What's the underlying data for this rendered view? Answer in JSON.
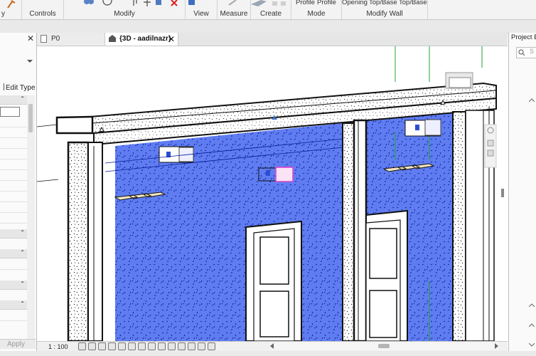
{
  "ribbon": {
    "groups": [
      {
        "id": "modify-partial",
        "label": "y"
      },
      {
        "id": "controls",
        "label": "Controls"
      },
      {
        "id": "modify",
        "label": "Modify"
      },
      {
        "id": "view",
        "label": "View"
      },
      {
        "id": "measure",
        "label": "Measure"
      },
      {
        "id": "create",
        "label": "Create"
      },
      {
        "id": "mode",
        "label": "Mode"
      },
      {
        "id": "modify-wall",
        "label": "Modify Wall"
      }
    ],
    "mode_buttons": {
      "edit_profile": "Profile",
      "reset_profile": "Profile"
    },
    "wall_buttons": {
      "opening": "Opening",
      "attach": "Top/Base",
      "detach": "Top/Base"
    }
  },
  "properties": {
    "close": "✕",
    "edit_type": "Edit Type",
    "apply": "Apply",
    "collapse": "⌃"
  },
  "tabs": [
    {
      "label": "P0",
      "active": false,
      "close": ""
    },
    {
      "label": "{3D - aadilnazr}",
      "active": true,
      "close": "✕"
    }
  ],
  "view_bar": {
    "scale": "1 : 100"
  },
  "project_browser": {
    "title": "Project B",
    "search_placeholder": "S"
  },
  "colors": {
    "wall_fill": "#5f7df0",
    "wall_speckle": "#0a1a9a",
    "selection_magenta": "#e040c8",
    "ribbon_bg": "#f3f3f3",
    "grid_green": "#22a03a"
  }
}
